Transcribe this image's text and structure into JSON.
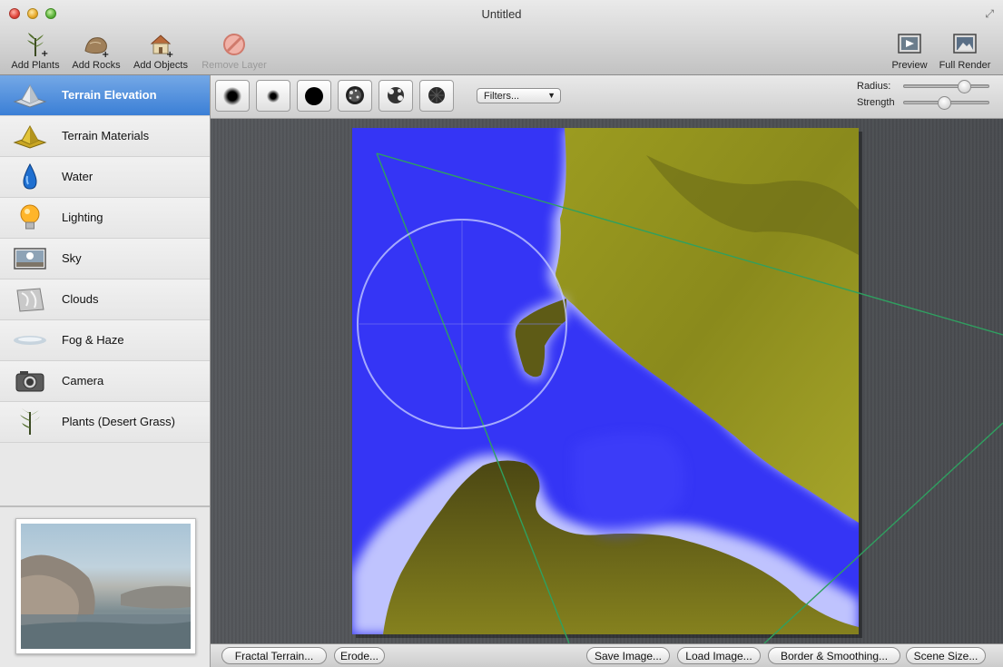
{
  "window": {
    "title": "Untitled"
  },
  "toolbar": {
    "add_plants": "Add Plants",
    "add_rocks": "Add Rocks",
    "add_objects": "Add Objects",
    "remove_layer": "Remove Layer",
    "preview": "Preview",
    "full_render": "Full Render"
  },
  "sidebar": {
    "items": [
      {
        "label": "Terrain Elevation",
        "icon": "terrain-elevation-icon",
        "active": true
      },
      {
        "label": "Terrain Materials",
        "icon": "terrain-materials-icon"
      },
      {
        "label": "Water",
        "icon": "water-drop-icon"
      },
      {
        "label": "Lighting",
        "icon": "lightbulb-icon"
      },
      {
        "label": "Sky",
        "icon": "sky-icon"
      },
      {
        "label": "Clouds",
        "icon": "clouds-icon"
      },
      {
        "label": "Fog & Haze",
        "icon": "fog-icon"
      },
      {
        "label": "Camera",
        "icon": "camera-icon"
      },
      {
        "label": "Plants (Desert Grass)",
        "icon": "plant-icon"
      }
    ]
  },
  "brush_tools": {
    "filters_label": "Filters...",
    "radius_label": "Radius:",
    "strength_label": "Strength",
    "radius_value": 0.75,
    "strength_value": 0.47
  },
  "bottom_bar": {
    "fractal_terrain": "Fractal Terrain...",
    "erode": "Erode...",
    "save_image": "Save Image...",
    "load_image": "Load Image...",
    "border_smoothing": "Border & Smoothing...",
    "scene_size": "Scene Size..."
  },
  "colors": {
    "water": "#3535f5",
    "terrain": "#9a9a20",
    "selection": "#3b7fd6",
    "camera_lines": "#2fa060"
  }
}
